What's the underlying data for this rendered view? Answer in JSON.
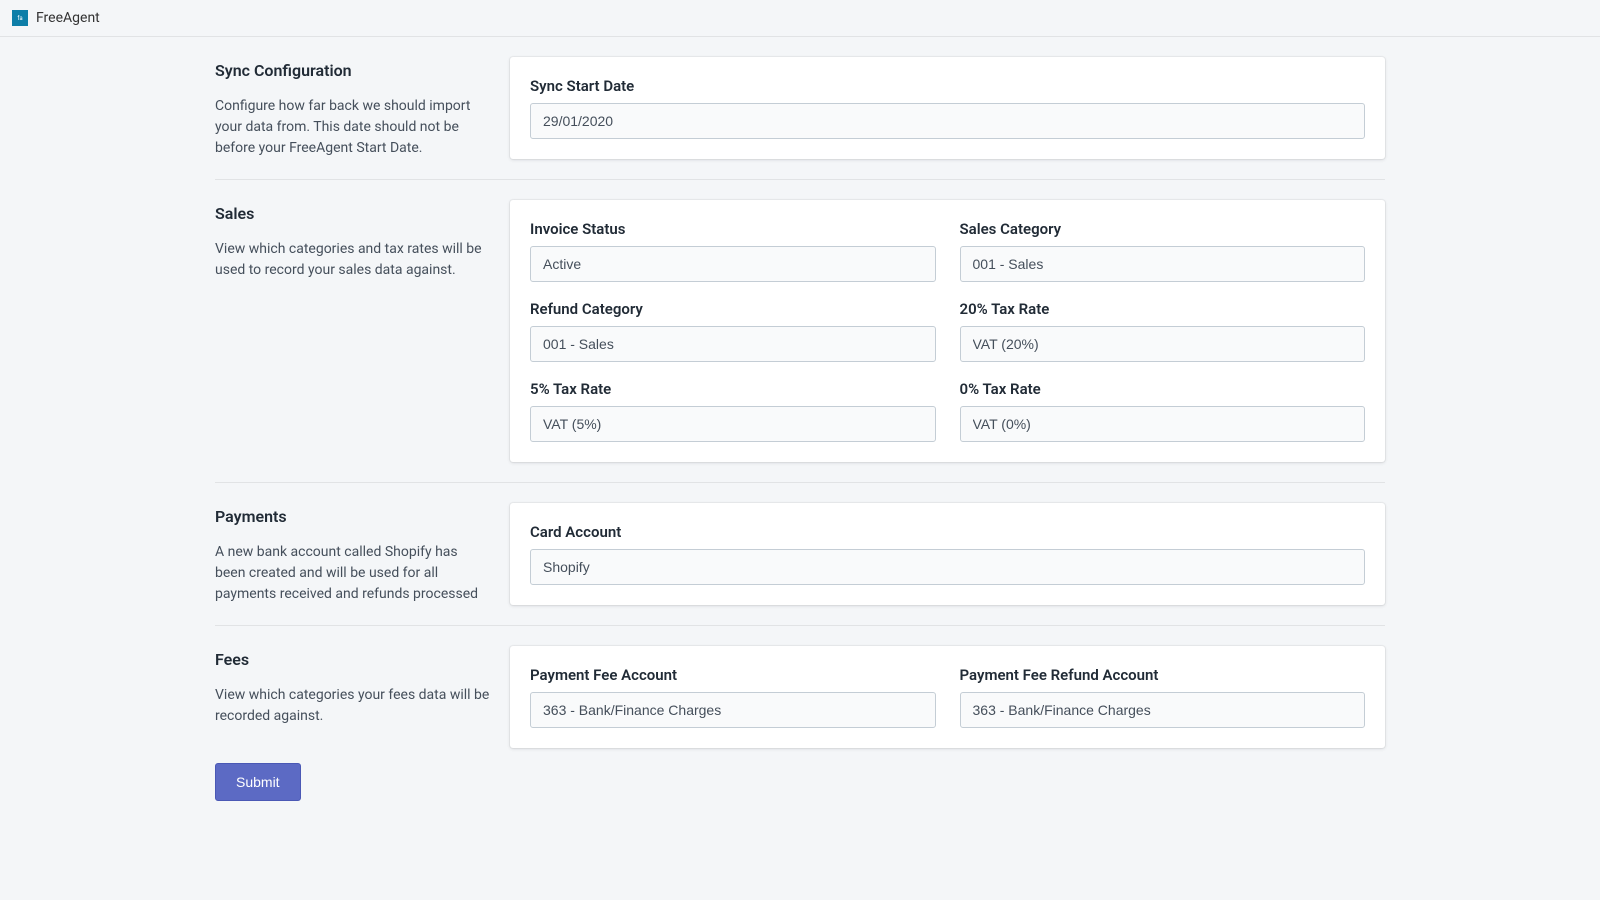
{
  "header": {
    "app_name": "FreeAgent"
  },
  "sections": {
    "sync": {
      "title": "Sync Configuration",
      "description": "Configure how far back we should import your data from. This date should not be before your FreeAgent Start Date.",
      "fields": {
        "start_date": {
          "label": "Sync Start Date",
          "value": "29/01/2020"
        }
      }
    },
    "sales": {
      "title": "Sales",
      "description": "View which categories and tax rates will be used to record your sales data against.",
      "fields": {
        "invoice_status": {
          "label": "Invoice Status",
          "value": "Active"
        },
        "sales_category": {
          "label": "Sales Category",
          "value": "001 - Sales"
        },
        "refund_category": {
          "label": "Refund Category",
          "value": "001 - Sales"
        },
        "tax_20": {
          "label": "20% Tax Rate",
          "value": "VAT (20%)"
        },
        "tax_5": {
          "label": "5% Tax Rate",
          "value": "VAT (5%)"
        },
        "tax_0": {
          "label": "0% Tax Rate",
          "value": "VAT (0%)"
        }
      }
    },
    "payments": {
      "title": "Payments",
      "description": "A new bank account called Shopify has been created and will be used for all payments received and refunds processed",
      "fields": {
        "card_account": {
          "label": "Card Account",
          "value": "Shopify"
        }
      }
    },
    "fees": {
      "title": "Fees",
      "description": "View which categories your fees data will be recorded against.",
      "fields": {
        "fee_account": {
          "label": "Payment Fee Account",
          "value": "363 - Bank/Finance Charges"
        },
        "fee_refund_account": {
          "label": "Payment Fee Refund Account",
          "value": "363 - Bank/Finance Charges"
        }
      }
    }
  },
  "actions": {
    "submit_label": "Submit"
  }
}
